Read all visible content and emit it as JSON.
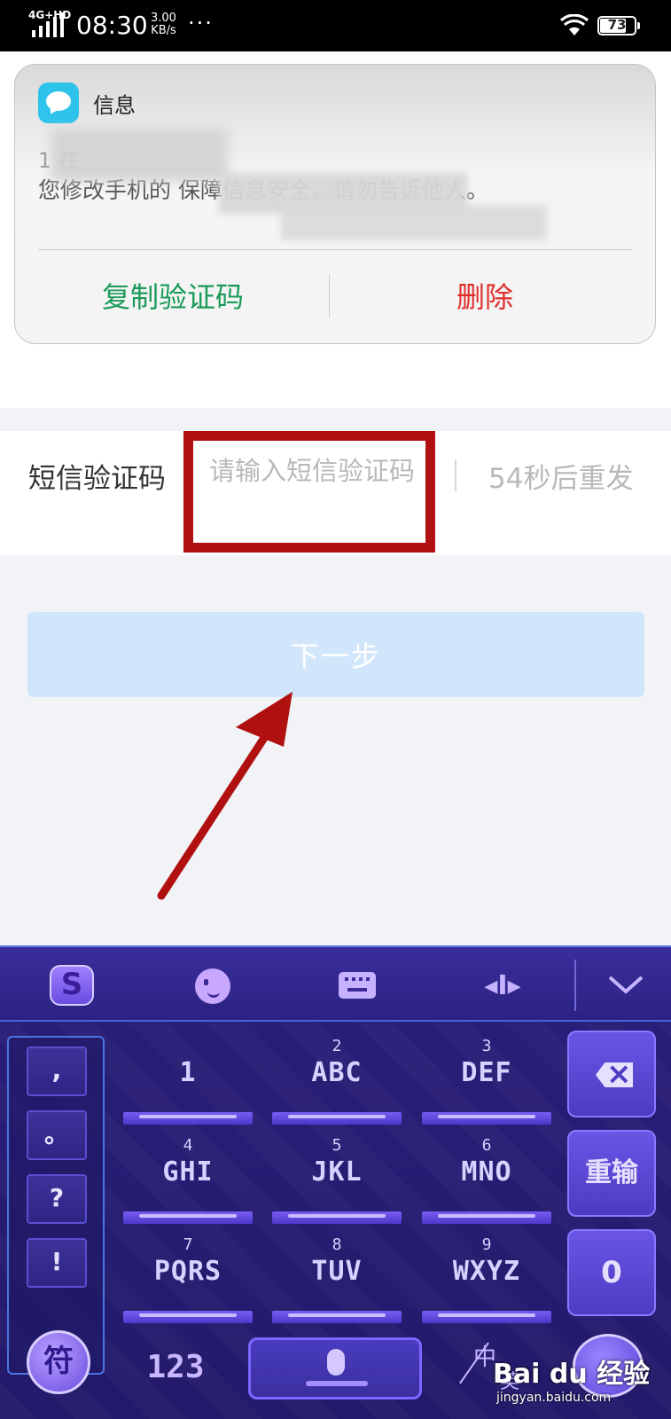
{
  "status_bar": {
    "network": "4G+HD",
    "time": "08:30",
    "speed_value": "3.00",
    "speed_unit": "KB/s",
    "more": "···",
    "battery": "73",
    "battery_level": 0.73
  },
  "notification": {
    "app_name": "信息",
    "sender_partial": "1 在",
    "body": "您修改手机的 保障信息安全，请勿告诉他人。",
    "copy_button": "复制验证码",
    "delete_button": "删除",
    "copy_color": "#1a9a5a",
    "delete_color": "#e02b2b"
  },
  "form": {
    "sms_label": "短信验证码",
    "sms_placeholder": "请输入短信验证码",
    "countdown": "54秒后重发",
    "next_button": "下一步",
    "highlight_color": "#b01010"
  },
  "keyboard": {
    "toolbar": {
      "logo": "S"
    },
    "symbols": [
      ",",
      "。",
      "?",
      "!"
    ],
    "keys": [
      {
        "digit": "",
        "letters": "1"
      },
      {
        "digit": "2",
        "letters": "ABC"
      },
      {
        "digit": "3",
        "letters": "DEF"
      },
      {
        "digit": "4",
        "letters": "GHI"
      },
      {
        "digit": "5",
        "letters": "JKL"
      },
      {
        "digit": "6",
        "letters": "MNO"
      },
      {
        "digit": "7",
        "letters": "PQRS"
      },
      {
        "digit": "8",
        "letters": "TUV"
      },
      {
        "digit": "9",
        "letters": "WXYZ"
      }
    ],
    "reset_key": "重输",
    "zero_key": "0",
    "symbol_key": "符",
    "num_key": "123",
    "lang_zh": "中",
    "lang_en": "英"
  },
  "watermark": {
    "logo": "Bai du 经验",
    "url": "jingyan.baidu.com"
  }
}
